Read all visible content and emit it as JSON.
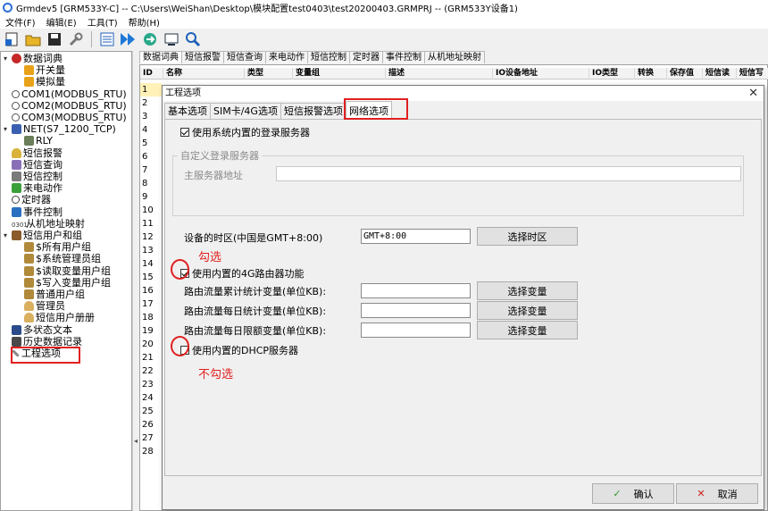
{
  "window": {
    "title": "Grmdev5 [GRM533Y-C]  -- C:\\Users\\WeiShan\\Desktop\\模块配置test0403\\test20200403.GRMPRJ  -- (GRM533Y设备1)"
  },
  "menu": [
    "文件(F)",
    "编辑(E)",
    "工具(T)",
    "帮助(H)"
  ],
  "tree": {
    "items": [
      {
        "label": "数据词典",
        "icon": "red-book-icon",
        "level": 0,
        "exp": "▾"
      },
      {
        "label": "开关量",
        "icon": "folder-icon",
        "level": 1,
        "exp": ""
      },
      {
        "label": "模拟量",
        "icon": "folder-icon",
        "level": 1,
        "exp": ""
      },
      {
        "label": "COM1(MODBUS_RTU)",
        "icon": "link-icon",
        "level": 0,
        "exp": ""
      },
      {
        "label": "COM2(MODBUS_RTU)",
        "icon": "link-icon",
        "level": 0,
        "exp": ""
      },
      {
        "label": "COM3(MODBUS_RTU)",
        "icon": "link-icon",
        "level": 0,
        "exp": ""
      },
      {
        "label": "NET(S7_1200_TCP)",
        "icon": "network-icon",
        "level": 0,
        "exp": "▾"
      },
      {
        "label": "RLY",
        "icon": "grid-icon",
        "level": 1,
        "exp": ""
      },
      {
        "label": "短信报警",
        "icon": "bell-icon",
        "level": 0,
        "exp": ""
      },
      {
        "label": "短信查询",
        "icon": "query-icon",
        "level": 0,
        "exp": ""
      },
      {
        "label": "短信控制",
        "icon": "mail-icon",
        "level": 0,
        "exp": ""
      },
      {
        "label": "来电动作",
        "icon": "phone-icon",
        "level": 0,
        "exp": ""
      },
      {
        "label": "定时器",
        "icon": "clock-icon",
        "level": 0,
        "exp": ""
      },
      {
        "label": "事件控制",
        "icon": "event-icon",
        "level": 0,
        "exp": ""
      },
      {
        "label": "从机地址映射",
        "icon": "number-icon",
        "level": 0,
        "exp": ""
      },
      {
        "label": "短信用户和组",
        "icon": "users-icon",
        "level": 0,
        "exp": "▾"
      },
      {
        "label": "$所有用户组",
        "icon": "group-icon",
        "level": 1,
        "exp": ""
      },
      {
        "label": "$系统管理员组",
        "icon": "group-icon",
        "level": 1,
        "exp": ""
      },
      {
        "label": "$读取变量用户组",
        "icon": "group-icon",
        "level": 1,
        "exp": ""
      },
      {
        "label": "$写入变量用户组",
        "icon": "group-icon",
        "level": 1,
        "exp": ""
      },
      {
        "label": "普通用户组",
        "icon": "group-icon",
        "level": 1,
        "exp": ""
      },
      {
        "label": "管理员",
        "icon": "user-icon",
        "level": 1,
        "exp": ""
      },
      {
        "label": "短信用户册册",
        "icon": "user-icon",
        "level": 1,
        "exp": ""
      },
      {
        "label": "多状态文本",
        "icon": "text-icon",
        "level": 0,
        "exp": ""
      },
      {
        "label": "历史数据记录",
        "icon": "history-icon",
        "level": 0,
        "exp": ""
      },
      {
        "label": "工程选项",
        "icon": "wrench-icon",
        "level": 0,
        "exp": ""
      }
    ]
  },
  "main_tabs": [
    "数据词典",
    "短信报警",
    "短信查询",
    "来电动作",
    "短信控制",
    "定时器",
    "事件控制",
    "从机地址映射"
  ],
  "grid": {
    "headers": [
      "ID",
      "名称",
      "类型",
      "变量组",
      "描述",
      "IO设备地址",
      "IO类型",
      "转换",
      "保存值",
      "短信读",
      "短信写"
    ],
    "rows": [
      "1",
      "2",
      "3",
      "4",
      "5",
      "6",
      "7",
      "8",
      "9",
      "10",
      "11",
      "12",
      "13",
      "14",
      "15",
      "16",
      "17",
      "18",
      "19",
      "20",
      "21",
      "22",
      "23",
      "24",
      "25",
      "26",
      "27",
      "28"
    ]
  },
  "dialog": {
    "title": "工程选项",
    "tabs": [
      "基本选项",
      "SIM卡/4G选项",
      "短信报警选项",
      "网络选项"
    ],
    "use_builtin_login": "使用系统内置的登录服务器",
    "custom_group": "自定义登录服务器",
    "main_server_label": "主服务器地址",
    "main_server_value": "",
    "timezone_label": "设备的时区(中国是GMT+8:00)",
    "timezone_value": "GMT+8:00",
    "choose_timezone": "选择时区",
    "use_4g_router": "使用内置的4G路由器功能",
    "traffic_total_label": "路由流量累计统计变量(单位KB):",
    "traffic_daily_label": "路由流量每日统计变量(单位KB):",
    "traffic_limit_label": "路由流量每日限额变量(单位KB):",
    "choose_var": "选择变量",
    "use_dhcp": "使用内置的DHCP服务器",
    "ok": "确认",
    "cancel": "取消"
  },
  "annotations": {
    "check_text": "勾选",
    "uncheck_text": "不勾选"
  },
  "colors": {
    "annotation": "#e02020",
    "selected_row": "#fff1b8"
  }
}
